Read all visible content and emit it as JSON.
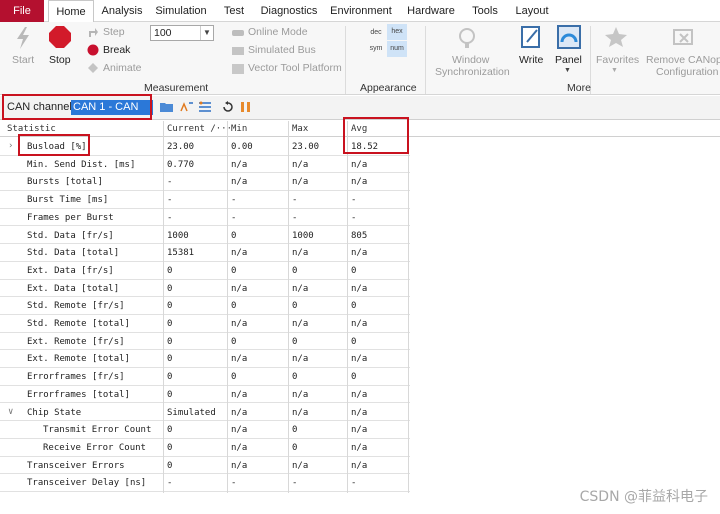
{
  "menu": {
    "tabs": [
      "File",
      "Home",
      "Analysis",
      "Simulation",
      "Test",
      "Diagnostics",
      "Environment",
      "Hardware",
      "Tools",
      "Layout"
    ],
    "active": "Home"
  },
  "ribbon": {
    "start_label": "Start",
    "stop_label": "Stop",
    "step_label": "Step",
    "break_label": "Break",
    "animate_label": "Animate",
    "speed_value": "100",
    "online_mode_label": "Online Mode",
    "simulated_bus_label": "Simulated Bus",
    "vector_tool_label": "Vector Tool Platform",
    "measurement_group": "Measurement",
    "dec_label": "dec",
    "hex_label": "hex",
    "sym_label": "sym",
    "num_label": "num",
    "appearance_group": "Appearance",
    "window_sync_line1": "Window",
    "window_sync_line2": "Synchronization",
    "write_label": "Write",
    "panel_label": "Panel",
    "favorites_label": "Favorites",
    "remove_line1": "Remove CANope",
    "remove_line2": "Configuration",
    "more_group": "More"
  },
  "toolbar": {
    "can_label": "CAN channel:",
    "can_value": "CAN 1 - CAN"
  },
  "table": {
    "columns": [
      "Statistic",
      "Current /···",
      "Min",
      "Max",
      "Avg"
    ],
    "rows": [
      {
        "name": "Busload [%]",
        "cur": "23.00",
        "min": "0.00",
        "max": "23.00",
        "avg": "18.52",
        "expand": ">"
      },
      {
        "name": "Min. Send Dist. [ms]",
        "cur": "0.770",
        "min": "n/a",
        "max": "n/a",
        "avg": "n/a"
      },
      {
        "name": "Bursts [total]",
        "cur": "-",
        "min": "n/a",
        "max": "n/a",
        "avg": "n/a"
      },
      {
        "name": "Burst Time [ms]",
        "cur": "-",
        "min": "-",
        "max": "-",
        "avg": "-"
      },
      {
        "name": "Frames per Burst",
        "cur": "-",
        "min": "-",
        "max": "-",
        "avg": "-"
      },
      {
        "name": "Std. Data [fr/s]",
        "cur": "1000",
        "min": "0",
        "max": "1000",
        "avg": "805"
      },
      {
        "name": "Std. Data [total]",
        "cur": "15381",
        "min": "n/a",
        "max": "n/a",
        "avg": "n/a"
      },
      {
        "name": "Ext. Data [fr/s]",
        "cur": "0",
        "min": "0",
        "max": "0",
        "avg": "0"
      },
      {
        "name": "Ext. Data [total]",
        "cur": "0",
        "min": "n/a",
        "max": "n/a",
        "avg": "n/a"
      },
      {
        "name": "Std. Remote [fr/s]",
        "cur": "0",
        "min": "0",
        "max": "0",
        "avg": "0"
      },
      {
        "name": "Std. Remote [total]",
        "cur": "0",
        "min": "n/a",
        "max": "n/a",
        "avg": "n/a"
      },
      {
        "name": "Ext. Remote [fr/s]",
        "cur": "0",
        "min": "0",
        "max": "0",
        "avg": "0"
      },
      {
        "name": "Ext. Remote [total]",
        "cur": "0",
        "min": "n/a",
        "max": "n/a",
        "avg": "n/a"
      },
      {
        "name": "Errorframes [fr/s]",
        "cur": "0",
        "min": "0",
        "max": "0",
        "avg": "0"
      },
      {
        "name": "Errorframes [total]",
        "cur": "0",
        "min": "n/a",
        "max": "n/a",
        "avg": "n/a"
      },
      {
        "name": "Chip State",
        "cur": "Simulated",
        "min": "n/a",
        "max": "n/a",
        "avg": "n/a",
        "expand": "v"
      },
      {
        "name": "Transmit Error Count",
        "cur": "0",
        "min": "n/a",
        "max": "0",
        "avg": "n/a",
        "indent": true
      },
      {
        "name": "Receive Error Count",
        "cur": "0",
        "min": "n/a",
        "max": "0",
        "avg": "n/a",
        "indent": true
      },
      {
        "name": "Transceiver Errors",
        "cur": "0",
        "min": "n/a",
        "max": "n/a",
        "avg": "n/a"
      },
      {
        "name": "Transceiver Delay [ns]",
        "cur": "-",
        "min": "-",
        "max": "-",
        "avg": "-"
      }
    ]
  },
  "watermark": "CSDN @菲益科电子",
  "colors": {
    "file_tab": "#b4102f",
    "highlight": "#2b78d8",
    "callout": "#c9121f"
  }
}
